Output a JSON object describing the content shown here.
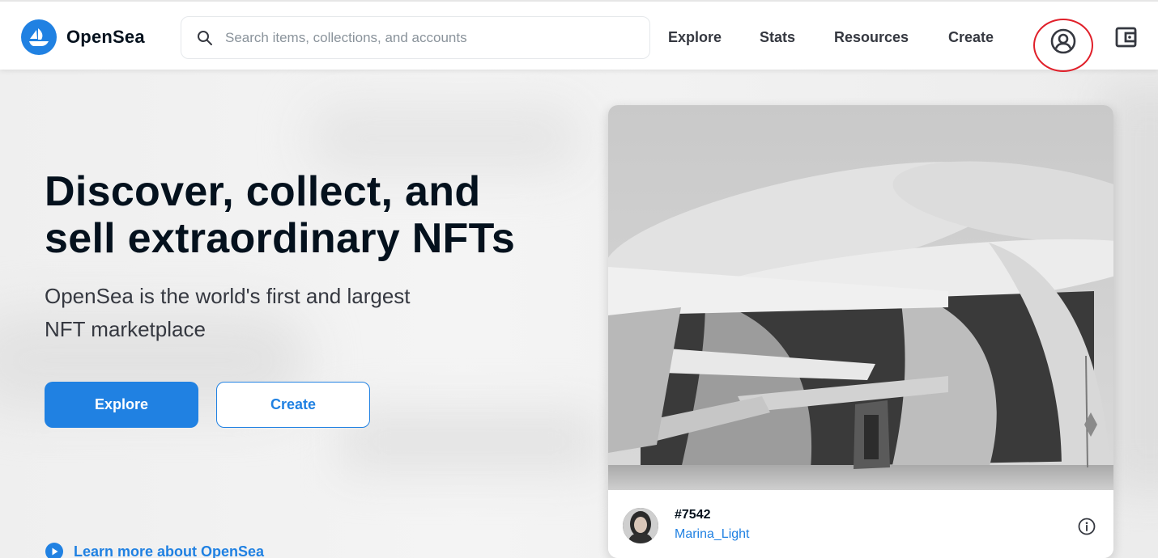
{
  "header": {
    "brand": "OpenSea",
    "search": {
      "placeholder": "Search items, collections, and accounts",
      "value": ""
    },
    "nav": [
      "Explore",
      "Stats",
      "Resources",
      "Create"
    ],
    "icons": {
      "logo": "opensea-boat-logo",
      "search": "search-icon",
      "account": "account-circle-icon",
      "wallet": "wallet-icon"
    }
  },
  "hero": {
    "title": "Discover, collect, and sell extraordinary NFTs",
    "subtitle": "OpenSea is the world's first and largest NFT marketplace",
    "primary_button": "Explore",
    "secondary_button": "Create",
    "learn_more": "Learn more about OpenSea",
    "learn_more_icon": "play-circle-icon"
  },
  "featured": {
    "name": "#7542",
    "creator": "Marina_Light",
    "info_icon": "info-icon",
    "image": "grayscale-architecture-artwork"
  },
  "colors": {
    "accent": "#2081e2",
    "text": "#04111d",
    "highlight": "#e0202a"
  }
}
